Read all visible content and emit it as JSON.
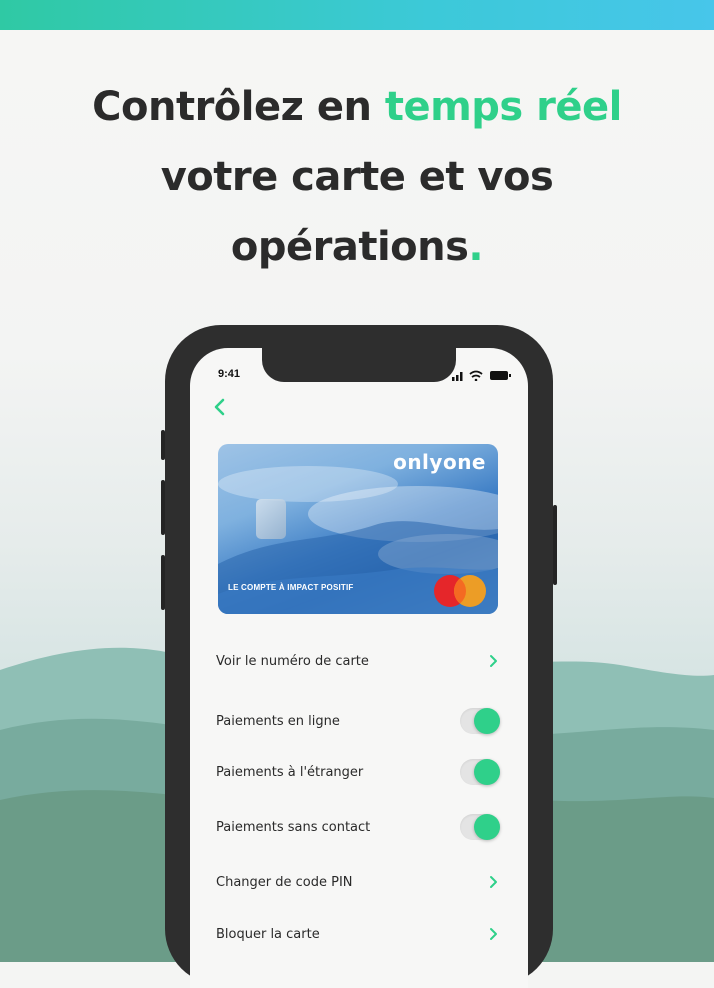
{
  "headline": {
    "line1_prefix": "Contrôlez en ",
    "line1_accent": "temps réel",
    "line2": "votre carte et vos",
    "line3": "opérations",
    "line3_dot": "."
  },
  "status_bar": {
    "time": "9:41"
  },
  "card": {
    "brand": "onlyone",
    "tagline": "LE COMPTE À IMPACT POSITIF"
  },
  "menu": {
    "view_number": "Voir le numéro de carte",
    "online_payments": "Paiements en ligne",
    "foreign_payments": "Paiements à l'étranger",
    "contactless_payments": "Paiements sans contact",
    "change_pin": "Changer de code PIN",
    "block_card": "Bloquer la carte"
  },
  "toggles": {
    "online_payments": true,
    "foreign_payments": true,
    "contactless_payments": true
  },
  "colors": {
    "accent": "#2fd08a",
    "top_bar": "#3cc9d8",
    "phone": "#2e2e2e",
    "text": "#2b2b2b"
  },
  "icons": [
    "chevron-left-icon",
    "chevron-right-icon",
    "signal-icon",
    "wifi-icon",
    "battery-icon",
    "mastercard-logo-icon"
  ]
}
